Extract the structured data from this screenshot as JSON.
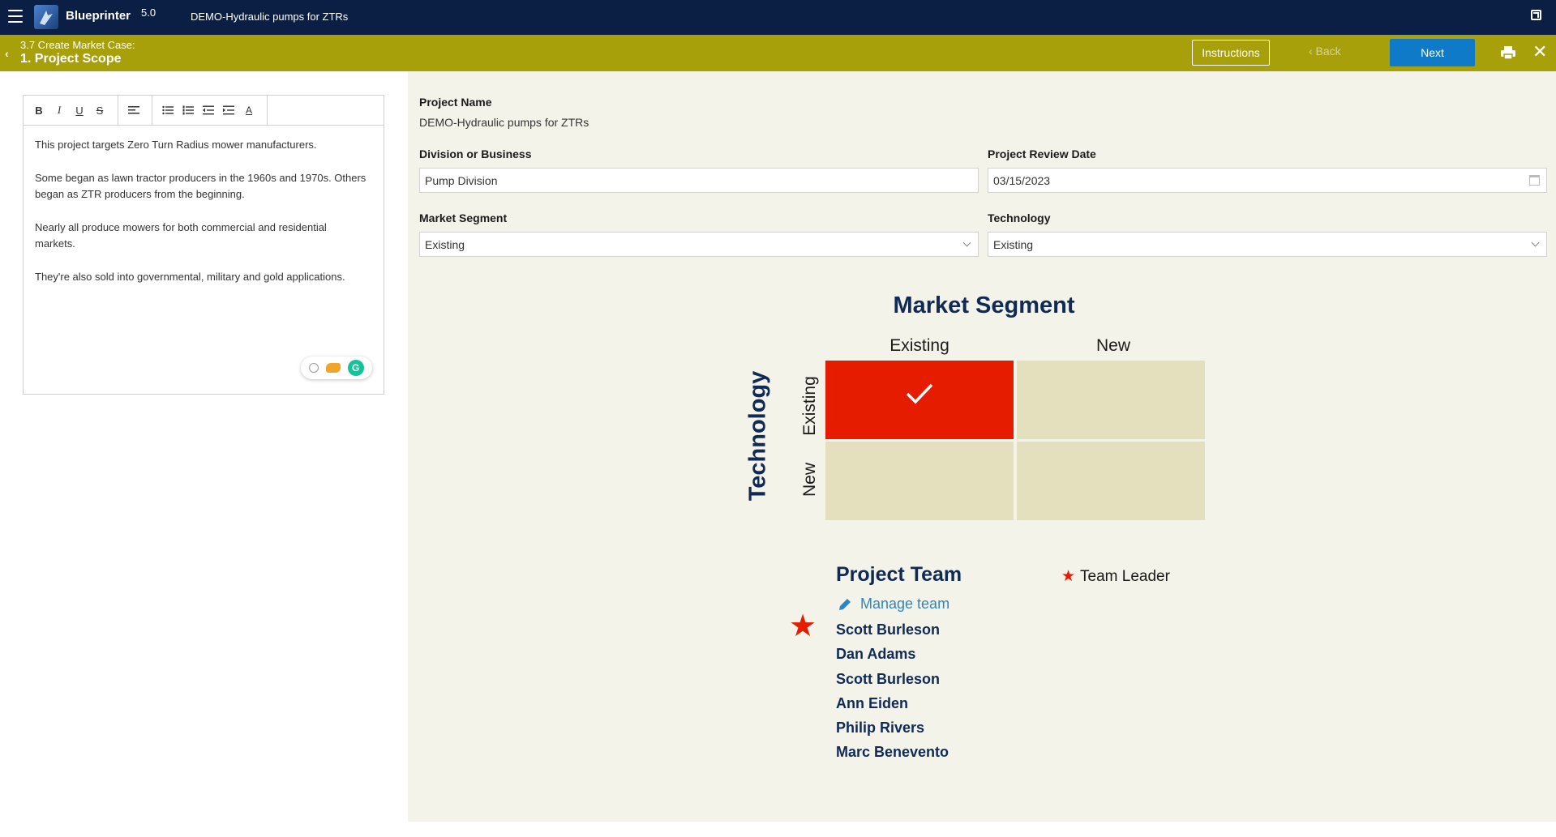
{
  "header": {
    "app_name": "Blueprinter",
    "app_version": "5.0",
    "project_title": "DEMO-Hydraulic pumps for ZTRs",
    "icons": [
      "menu-icon",
      "app-logo-icon",
      "popout-icon"
    ]
  },
  "stepbar": {
    "back_chevron": "‹",
    "subtitle": "3.7 Create Market Case:",
    "title": "1. Project Scope",
    "instructions_label": "Instructions",
    "back_label": "‹  Back",
    "next_label": "Next",
    "close_glyph": "✕",
    "icons": [
      "print-icon",
      "close-icon"
    ]
  },
  "editor": {
    "toolbar": {
      "bold": "B",
      "italic": "I",
      "underline": "U",
      "strike": "S",
      "font_color": "A"
    },
    "paragraphs": [
      "This project targets Zero Turn Radius mower manufacturers.",
      "Some began as lawn tractor producers in the 1960s and 1970s. Others began as ZTR producers from the beginning.",
      "Nearly all produce mowers for both commercial and residential markets.",
      "They're also sold into governmental, military and gold applications."
    ],
    "grammarly_letter": "G"
  },
  "form": {
    "project_name_label": "Project Name",
    "project_name_value": "DEMO-Hydraulic pumps for ZTRs",
    "division_label": "Division or Business",
    "division_value": "Pump Division",
    "review_date_label": "Project Review Date",
    "review_date_value": "03/15/2023",
    "market_segment_label": "Market Segment",
    "market_segment_value": "Existing",
    "technology_label": "Technology",
    "technology_value": "Existing"
  },
  "matrix": {
    "title": "Market Segment",
    "col_labels": [
      "Existing",
      "New"
    ],
    "row_title": "Technology",
    "row_labels": [
      "Existing",
      "New"
    ],
    "selected": {
      "market_segment": "Existing",
      "technology": "Existing"
    },
    "colors": {
      "selected": "#e61c00",
      "unselected": "#e4e0bd",
      "title": "#0f2a55"
    }
  },
  "team": {
    "title": "Project Team",
    "legend_label": "Team Leader",
    "manage_label": "Manage team",
    "leader": "Scott Burleson",
    "members": [
      "Scott Burleson",
      "Dan Adams",
      "Scott Burleson",
      "Ann Eiden",
      "Philip Rivers",
      "Marc Benevento"
    ]
  },
  "colors": {
    "topbar": "#0b1f44",
    "stepbar": "#a8a00b",
    "next_button": "#0f7ac7",
    "main_bg": "#f4f3ea",
    "link": "#2a86c6"
  }
}
